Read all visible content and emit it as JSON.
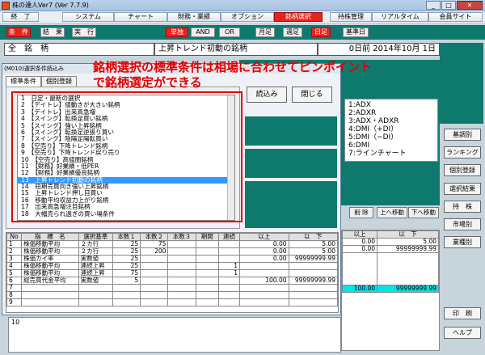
{
  "window": {
    "title": "株の達人Ver7 (Ver 7.7.9)"
  },
  "menu": [
    {
      "label": "終　了"
    },
    {
      "label": "システム"
    },
    {
      "label": "チャート"
    },
    {
      "label": "財務・業績"
    },
    {
      "label": "オプション"
    },
    {
      "label": "銘柄選択"
    },
    {
      "label": "持株管理"
    },
    {
      "label": "リアルタイム"
    },
    {
      "label": "会員サイト"
    }
  ],
  "toolbar": [
    {
      "label": "条　件"
    },
    {
      "label": "結　果"
    },
    {
      "label": "実　行"
    },
    {
      "label": "単独"
    },
    {
      "label": "AND"
    },
    {
      "label": "OR"
    },
    {
      "label": "月足"
    },
    {
      "label": "週足"
    },
    {
      "label": "日足"
    },
    {
      "label": "基準日"
    }
  ],
  "header": {
    "scope": "全　銘　柄",
    "condition": "上昇トレンド初動の銘柄",
    "date": "0日前 2014年10月 1日"
  },
  "annotation": {
    "line1": "銘柄選択の標準条件は相場に合わせてピンポイント",
    "line2": "で銘柄選定ができる"
  },
  "dialog": {
    "title": "(M010)選択条件読込み",
    "tabs": [
      "標準条件",
      "個別登録"
    ],
    "load_button": "読込み",
    "close_button": "閉じる",
    "items": [
      "1　日足・最新の選択",
      "2　【デイトレ】値動きが大きい銘柄",
      "3　【デイトレ】出来高急増",
      "4　【スイング】転換足買い銘柄",
      "5　【スイング】強い上昇銘柄",
      "6　【スイング】転換足逆張り買い",
      "7　【スイング】陰陽足陽転買い",
      "8　【空売り】下降トレンド銘柄",
      "9　【空売り】下降トレンド戻り売り",
      "10　【空売り】高値圏銘柄",
      "11　【財務】好業績・低PER",
      "12　【財務】好業績優良銘柄",
      "13　上昇トレンド初動の銘柄",
      "14　短期売買向き強い上昇銘柄",
      "15　上昇トレンド押し目買い",
      "16　移動平均収益力上がり銘柄",
      "17　出来高急増注目銘柄",
      "18　大幅売られ過ぎの買い場条件"
    ],
    "selected_index": 12
  },
  "grid": {
    "headers": [
      "No",
      "指　標　名",
      "選択基準",
      "本数１",
      "本数２",
      "本数３",
      "期間",
      "連続",
      "以上",
      "以　下"
    ],
    "rows": [
      [
        "1",
        "株価移動平均",
        "２カ行",
        "25",
        "75",
        "",
        "",
        "",
        "0.00",
        "5.00"
      ],
      [
        "2",
        "株価移動平均",
        "２カ行",
        "25",
        "200",
        "",
        "",
        "",
        "0.00",
        "5.00"
      ],
      [
        "3",
        "株価カイ率",
        "実数値",
        "25",
        "",
        "",
        "",
        "",
        "0.00",
        "99999999.99"
      ],
      [
        "4",
        "株価移動平均",
        "連続上昇",
        "25",
        "",
        "",
        "",
        "1",
        "",
        ""
      ],
      [
        "5",
        "株価移動平均",
        "連続上昇",
        "75",
        "",
        "",
        "",
        "1",
        "",
        ""
      ],
      [
        "6",
        "総売買代金平均",
        "実数値",
        "5",
        "",
        "",
        "",
        "",
        "100.00",
        "99999999.99"
      ],
      [
        "7",
        "",
        "",
        "",
        "",
        "",
        "",
        "",
        "",
        ""
      ],
      [
        "8",
        "",
        "",
        "",
        "",
        "",
        "",
        "",
        "",
        ""
      ],
      [
        "9",
        "",
        "",
        "",
        "",
        "",
        "",
        "",
        "",
        ""
      ],
      [
        "10",
        "",
        "",
        "",
        "",
        "",
        "",
        "",
        "",
        ""
      ]
    ]
  },
  "right_list": [
    "1:ADX",
    "2:ADXR",
    "3:ADX・ADXR",
    "4:DMI（+DI）",
    "5:DMI（−DI）",
    "6:DMI",
    "7:ラインチャート"
  ],
  "small_buttons": [
    "削 除",
    "上へ移動",
    "下へ移動"
  ],
  "bg_table": {
    "headers": [
      "以上",
      "以　下"
    ],
    "rows": [
      [
        "0.00",
        "5.00"
      ],
      [
        "0.00",
        "99999999.99"
      ],
      [
        "100.00",
        "99999999.99"
      ]
    ]
  },
  "side_buttons": [
    "基調別",
    "ランキング",
    "個別登録",
    "選択結果",
    "持　株",
    "市場別",
    "業種別",
    "印　刷",
    "ヘルプ"
  ]
}
